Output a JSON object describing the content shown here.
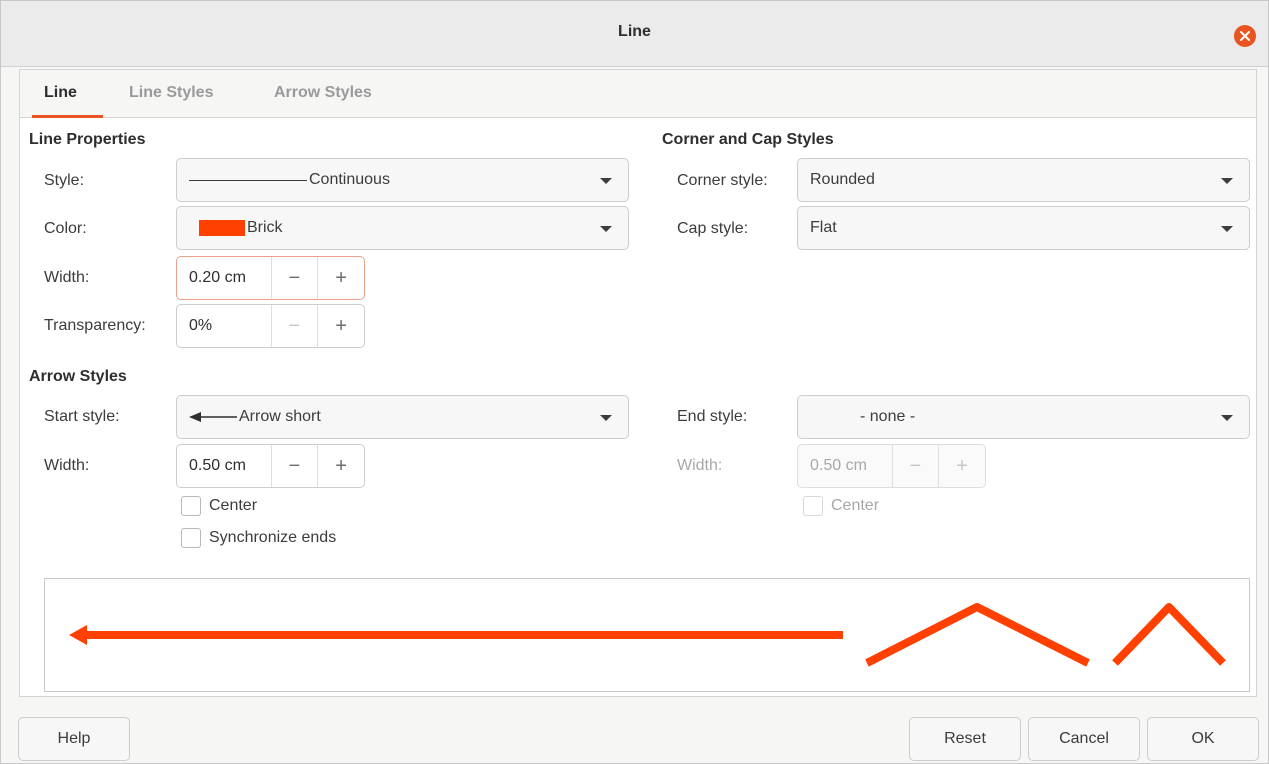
{
  "window": {
    "title": "Line"
  },
  "tabs": [
    {
      "label": "Line"
    },
    {
      "label": "Line Styles"
    },
    {
      "label": "Arrow Styles"
    }
  ],
  "line_properties": {
    "title": "Line Properties",
    "style_label": "Style:",
    "style_value": "Continuous",
    "color_label": "Color:",
    "color_value": "Brick",
    "color_hex": "#ff4000",
    "width_label": "Width:",
    "width_value": "0.20 cm",
    "transparency_label": "Transparency:",
    "transparency_value": "0%"
  },
  "corner_cap": {
    "title": "Corner and Cap Styles",
    "corner_label": "Corner style:",
    "corner_value": "Rounded",
    "cap_label": "Cap style:",
    "cap_value": "Flat"
  },
  "arrow_styles": {
    "title": "Arrow Styles",
    "start_label": "Start style:",
    "start_value": "Arrow short",
    "start_width_label": "Width:",
    "start_width_value": "0.50 cm",
    "center_label": "Center",
    "sync_label": "Synchronize ends",
    "end_label": "End style:",
    "end_value": "- none -",
    "end_width_label": "Width:",
    "end_width_value": "0.50 cm",
    "end_center_label": "Center"
  },
  "spin_glyphs": {
    "minus": "−",
    "plus": "+"
  },
  "buttons": {
    "help": "Help",
    "reset": "Reset",
    "cancel": "Cancel",
    "ok": "OK"
  },
  "colors": {
    "accent": "#e95420",
    "line_color": "#ff4000"
  },
  "icons": {
    "close": "close-icon",
    "dropdown": "chevron-down-icon"
  }
}
